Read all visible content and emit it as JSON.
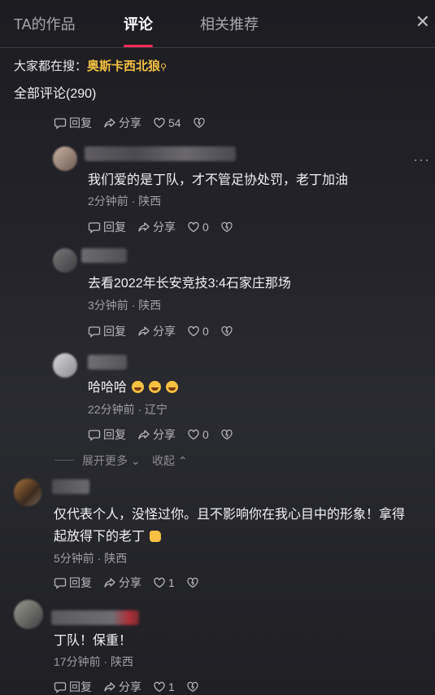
{
  "tabs": [
    {
      "label": "TA的作品"
    },
    {
      "label": "评论"
    },
    {
      "label": "相关推荐"
    }
  ],
  "close_label": "✕",
  "hot_search": {
    "prefix": "大家都在搜：",
    "keyword": "奥斯卡西北狼"
  },
  "comment_count": "全部评论(290)",
  "action_labels": {
    "reply": "回复",
    "share": "分享"
  },
  "top_actions": {
    "likes": "54"
  },
  "replies": [
    {
      "text": "我们爱的是丁队，才不管足协处罚，老丁加油",
      "time": "2分钟前",
      "region": "陕西",
      "likes": "0"
    },
    {
      "text": "去看2022年长安竞技3:4石家庄那场",
      "time": "3分钟前",
      "region": "陕西",
      "likes": "0"
    },
    {
      "text": "哈哈哈",
      "time": "22分钟前",
      "region": "辽宁",
      "likes": "0"
    }
  ],
  "expand": {
    "more": "展开更多",
    "collapse": "收起"
  },
  "comments": [
    {
      "line1": "仅代表个人，没怪过你。且不影响你在我心目中的形象！拿得",
      "line2": "起放得下的老丁",
      "time": "5分钟前",
      "region": "陕西",
      "likes": "1"
    },
    {
      "text": "丁队！保重！",
      "time": "17分钟前",
      "region": "陕西",
      "likes": "1"
    }
  ],
  "meta_separator": " · ",
  "colors": {
    "accent": "#fe2c55",
    "keyword": "#f5c242",
    "background": "#1f1f24"
  }
}
